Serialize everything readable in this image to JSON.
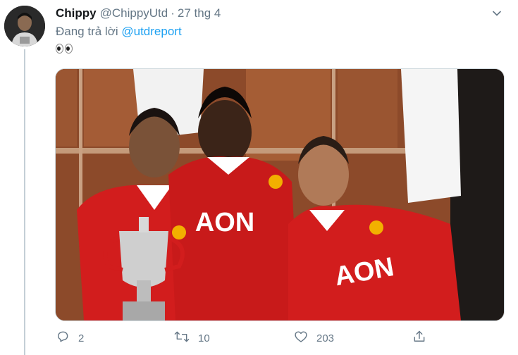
{
  "tweet": {
    "display_name": "Chippy",
    "handle": "@ChippyUtd",
    "separator": "·",
    "date": "27 thg 4",
    "reply_prefix": "Đang trả lời",
    "reply_mention": "@utdreport",
    "body_emoji": "eyes-emoji",
    "photo_icon": "team-photo-trophy"
  },
  "actions": {
    "reply_count": "2",
    "retweet_count": "10",
    "like_count": "203"
  },
  "colors": {
    "link": "#1da1f2",
    "secondary_text": "#657786",
    "thread_line": "#c4cfd6",
    "jersey_red": "#d21d1d"
  }
}
